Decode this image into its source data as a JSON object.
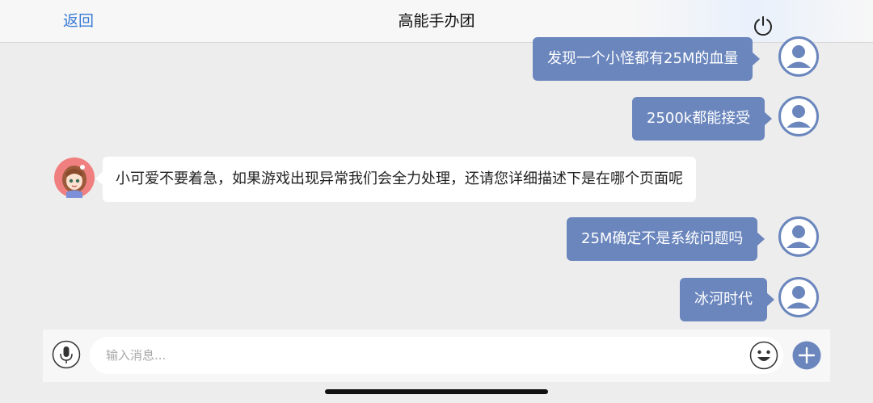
{
  "header": {
    "back_label": "返回",
    "title": "高能手办团"
  },
  "messages": [
    {
      "side": "out",
      "text": "发现一个小怪都有25M的血量"
    },
    {
      "side": "out",
      "text": "2500k都能接受"
    },
    {
      "side": "in",
      "text": "小可爱不要着急，如果游戏出现异常我们会全力处理，还请您详细描述下是在哪个页面呢"
    },
    {
      "side": "out",
      "text": "25M确定不是系统问题吗"
    },
    {
      "side": "out",
      "text": "冰河时代"
    }
  ],
  "input": {
    "placeholder": "输入消息..."
  },
  "icons": {
    "power": "power-icon",
    "mic": "microphone-icon",
    "emoji": "emoji-icon",
    "add": "plus-icon",
    "user_avatar": "user-avatar-icon",
    "bot_avatar": "anime-girl-avatar"
  },
  "colors": {
    "outgoing_bubble": "#6a86bd",
    "accent": "#3a7bd5"
  }
}
